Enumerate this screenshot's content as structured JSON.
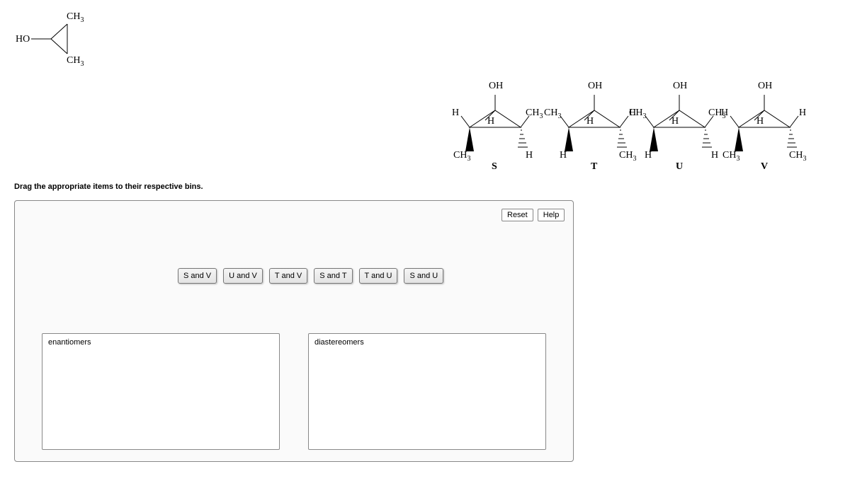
{
  "reference_structure": {
    "left": "HO",
    "top_right": "CH3",
    "bottom_right": "CH3"
  },
  "structures": [
    {
      "id": "S",
      "labels": {
        "top": "OH",
        "up_left": "H",
        "up_right": "CH3",
        "in_left": "H",
        "down_left": "CH3",
        "down_right": "H"
      }
    },
    {
      "id": "T",
      "labels": {
        "top": "OH",
        "up_left": "CH3",
        "up_right": "H",
        "in_left": "H",
        "down_left": "H",
        "down_right": "CH3"
      }
    },
    {
      "id": "U",
      "labels": {
        "top": "OH",
        "up_left": "CH3",
        "up_right": "CH3",
        "in_left": "H",
        "down_left": "H",
        "down_right": "H"
      }
    },
    {
      "id": "V",
      "labels": {
        "top": "OH",
        "up_left": "H",
        "up_right": "H",
        "in_left": "H",
        "down_left": "CH3",
        "down_right": "CH3"
      }
    }
  ],
  "instruction": "Drag the appropriate items to their respective bins.",
  "buttons": {
    "reset": "Reset",
    "help": "Help"
  },
  "drag_items": [
    "S and V",
    "U and V",
    "T and V",
    "S and T",
    "T and U",
    "S and U"
  ],
  "bins": {
    "left": "enantiomers",
    "right": "diastereomers"
  }
}
